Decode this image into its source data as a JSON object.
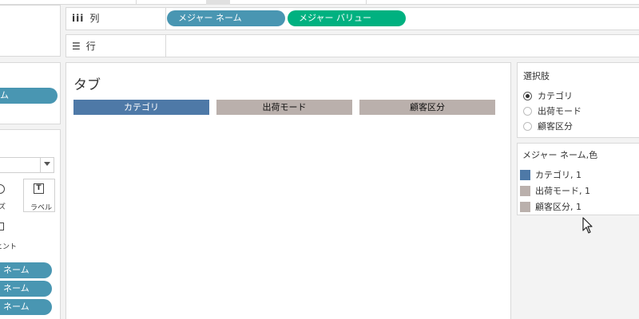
{
  "shelves": {
    "columns": {
      "icon": "iii",
      "label": "列",
      "pills": [
        "メジャー ネーム",
        "メジャー バリュー"
      ]
    },
    "rows": {
      "icon": "☰",
      "label": "行"
    }
  },
  "left": {
    "top_pill": "ム",
    "marks": {
      "size_label": "ズ",
      "label_label": "ラベル",
      "tooltip_label": "ヒント"
    },
    "pills": [
      "ネーム",
      "ネーム",
      "ネーム"
    ]
  },
  "view": {
    "title": "タブ",
    "tabs": [
      {
        "label": "カテゴリ",
        "color": "#4e79a7"
      },
      {
        "label": "出荷モード",
        "color": "#bab0ac"
      },
      {
        "label": "顧客区分",
        "color": "#bab0ac"
      }
    ]
  },
  "parameter": {
    "title": "選択肢",
    "options": [
      "カテゴリ",
      "出荷モード",
      "顧客区分"
    ],
    "selected": 0
  },
  "legend": {
    "title": "メジャー ネーム,色",
    "items": [
      {
        "label": "カテゴリ, 1",
        "color": "#4e79a7"
      },
      {
        "label": "出荷モード, 1",
        "color": "#bab0ac"
      },
      {
        "label": "顧客区分, 1",
        "color": "#bab0ac"
      }
    ]
  },
  "colors": {
    "pill_blue": "#4996b2",
    "pill_green": "#00b180",
    "tab_selected": "#4e79a7",
    "tab_unselected": "#bab0ac"
  }
}
